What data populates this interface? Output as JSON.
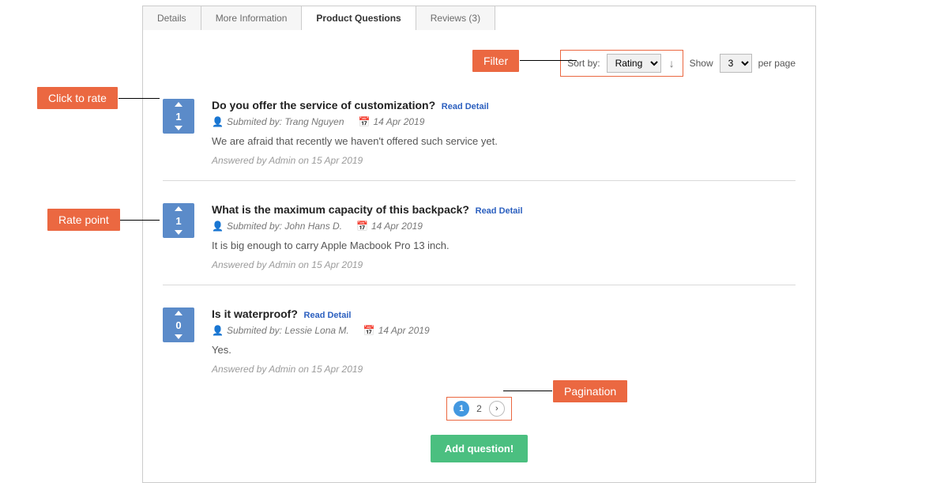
{
  "tabs": [
    {
      "label": "Details"
    },
    {
      "label": "More Information"
    },
    {
      "label": "Product Questions"
    },
    {
      "label": "Reviews (3)"
    }
  ],
  "toolbar": {
    "sort_label": "Sort by:",
    "sort_value": "Rating",
    "show_label": "Show",
    "show_value": "3",
    "per_page_label": "per page"
  },
  "questions": [
    {
      "rating": "1",
      "title": "Do you offer the service of customization?",
      "read_detail": "Read Detail",
      "submitted_label": "Submited by:",
      "author": "Trang Nguyen",
      "date": "14 Apr 2019",
      "answer": "We are afraid that recently we haven't offered such service yet.",
      "answered_by": "Answered by Admin on 15 Apr 2019"
    },
    {
      "rating": "1",
      "title": "What is the maximum capacity of this backpack?",
      "read_detail": "Read Detail",
      "submitted_label": "Submited by:",
      "author": "John Hans D.",
      "date": "14 Apr 2019",
      "answer": "It is big enough to carry Apple Macbook Pro 13 inch.",
      "answered_by": "Answered by Admin on 15 Apr 2019"
    },
    {
      "rating": "0",
      "title": "Is it waterproof?",
      "read_detail": "Read Detail",
      "submitted_label": "Submited by:",
      "author": "Lessie Lona M.",
      "date": "14 Apr 2019",
      "answer": "Yes.",
      "answered_by": "Answered by Admin on 15 Apr 2019"
    }
  ],
  "pagination": {
    "current": "1",
    "next": "2"
  },
  "add_question_label": "Add question!",
  "callouts": {
    "click_to_rate": "Click to rate",
    "rate_point": "Rate point",
    "filter": "Filter",
    "pagination": "Pagination"
  }
}
